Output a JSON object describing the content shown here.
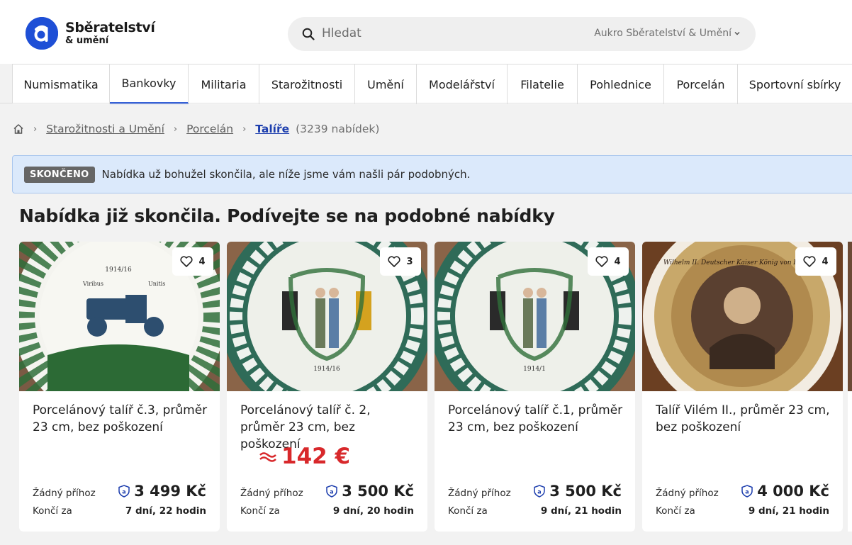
{
  "header": {
    "logo_title": "Sběratelství",
    "logo_sub": "& umění",
    "search_placeholder": "Hledat",
    "search_scope": "Aukro Sběratelství & Umění"
  },
  "nav": {
    "tabs": [
      {
        "label": "Numismatika"
      },
      {
        "label": "Bankovky"
      },
      {
        "label": "Militaria"
      },
      {
        "label": "Starožitnosti"
      },
      {
        "label": "Umění"
      },
      {
        "label": "Modelářství"
      },
      {
        "label": "Filatelie"
      },
      {
        "label": "Pohlednice"
      },
      {
        "label": "Porcelán"
      },
      {
        "label": "Sportovní sbírky"
      }
    ],
    "active": "Bankovky"
  },
  "breadcrumb": {
    "items": [
      "Starožitnosti a Umění",
      "Porcelán"
    ],
    "current": "Talíře",
    "count": "(3239 nabídek)"
  },
  "banner": {
    "badge": "SKONČENO",
    "text": "Nabídka už bohužel skončila, ale níže jsme vám našli pár podobných."
  },
  "section_title": "Nabídka již skončila. Podívejte se na podobné nabídky",
  "cards": [
    {
      "title": "Porcelánový talíř č.3, průměr 23 cm, bez poškození",
      "favorites": "4",
      "bids": "Žádný příhoz",
      "price": "3 499 Kč",
      "ends_label": "Končí za",
      "time_left": "7 dní, 22 hodin",
      "approx": ""
    },
    {
      "title": "Porcelánový talíř č. 2, průměr 23 cm, bez poškození",
      "favorites": "3",
      "bids": "Žádný příhoz",
      "price": "3 500 Kč",
      "ends_label": "Končí za",
      "time_left": "9 dní, 20 hodin",
      "approx": "142 €"
    },
    {
      "title": "Porcelánový talíř č.1, průměr 23 cm, bez poškození",
      "favorites": "4",
      "bids": "Žádný příhoz",
      "price": "3 500 Kč",
      "ends_label": "Končí za",
      "time_left": "9 dní, 21 hodin",
      "approx": ""
    },
    {
      "title": "Talíř Vilém II., průměr 23 cm, bez poškození",
      "favorites": "4",
      "bids": "Žádný příhoz",
      "price": "4 000 Kč",
      "ends_label": "Končí za",
      "time_left": "9 dní, 21 hodin",
      "approx": ""
    }
  ],
  "plate_texts": {
    "card0_year": "1914/16",
    "card0_left": "Viribus",
    "card0_right": "Unitis",
    "card1_year": "1914/16",
    "card2_year": "1914/1",
    "card3_rim": "Wilhelm II. Deutscher Kaiser König von Preußen"
  },
  "colors": {
    "brand": "#1e4fd6",
    "price_red": "#d8282b",
    "banner_bg": "#dbe9fb"
  },
  "icons": {
    "search": "search-icon",
    "home": "home-icon",
    "heart": "heart-icon",
    "chevron": "chevron-down-icon",
    "approx": "approx-icon",
    "aukro_badge": "aukro-shield-icon"
  }
}
